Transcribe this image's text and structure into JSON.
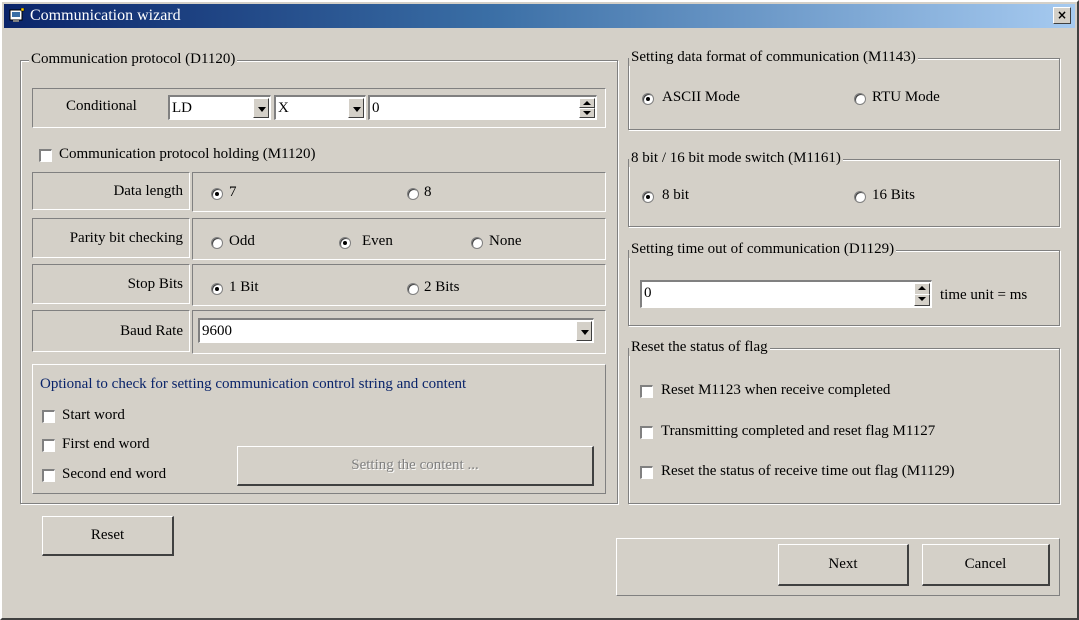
{
  "window": {
    "title": "Communication wizard",
    "close_glyph": "×"
  },
  "protocol": {
    "legend": "Communication protocol (D1120)",
    "conditional_label": "Conditional",
    "cond_op": "LD",
    "cond_device": "X",
    "cond_value": "0",
    "holding_label": "Communication protocol holding (M1120)",
    "holding_checked": false,
    "data_length_label": "Data length",
    "data_length_options": [
      "7",
      "8"
    ],
    "data_length_selected": "7",
    "parity_label": "Parity bit checking",
    "parity_options": [
      "Odd",
      "Even",
      "None"
    ],
    "parity_selected": "Even",
    "stop_bits_label": "Stop Bits",
    "stop_bits_options": [
      "1 Bit",
      "2 Bits"
    ],
    "stop_bits_selected": "1 Bit",
    "baud_rate_label": "Baud Rate",
    "baud_rate_value": "9600"
  },
  "optional": {
    "title": "Optional to check for setting communication control string and content",
    "start_word": "Start word",
    "first_end_word": "First end word",
    "second_end_word": "Second end word",
    "setting_content_button": "Setting the content ..."
  },
  "data_format": {
    "legend": "Setting data format of communication (M1143)",
    "ascii": "ASCII Mode",
    "rtu": "RTU Mode",
    "selected": "ASCII Mode"
  },
  "bit_mode": {
    "legend": "8 bit / 16 bit mode switch (M1161)",
    "opt8": "8 bit",
    "opt16": "16 Bits",
    "selected": "8 bit"
  },
  "timeout": {
    "legend": "Setting time out of communication (D1129)",
    "value": "0",
    "unit_label": "time unit = ms"
  },
  "reset_flag": {
    "legend": "Reset the status of flag",
    "items": [
      "Reset M1123 when receive completed",
      "Transmitting completed and reset flag M1127",
      "Reset the status of receive time out flag (M1129)"
    ]
  },
  "buttons": {
    "reset": "Reset",
    "next": "Next",
    "cancel": "Cancel"
  },
  "colors": {
    "face": "#d4d0c8",
    "title_start": "#0a246a",
    "title_end": "#a6caf0",
    "optional_text": "#0a246a"
  },
  "icons": {
    "app": "window-app-icon",
    "close": "close-icon"
  }
}
